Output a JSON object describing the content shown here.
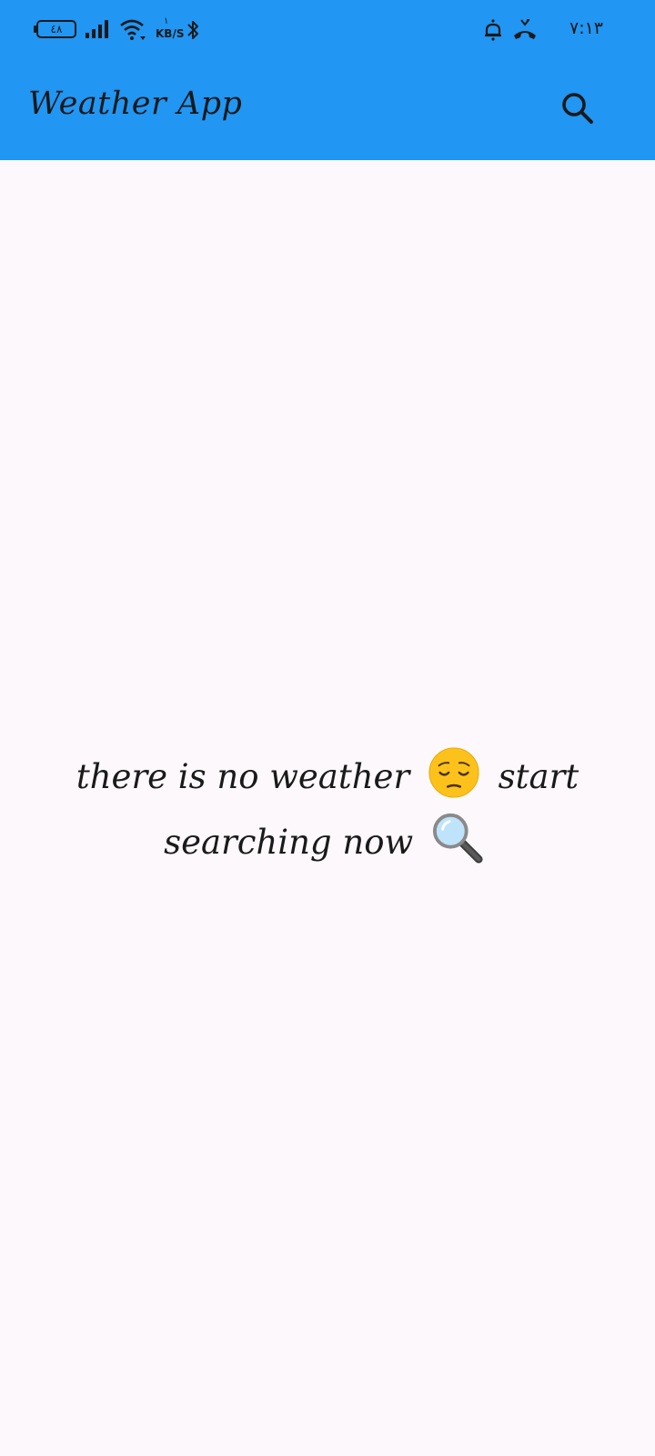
{
  "status_bar": {
    "battery_level": "٤٨",
    "network_speed_value": "١",
    "network_speed_unit": "KB/S",
    "time": "٧:١٣",
    "icons": [
      "battery-icon",
      "signal-icon",
      "wifi-icon",
      "bluetooth-icon",
      "alarm-icon",
      "call-icon"
    ]
  },
  "app_bar": {
    "title": "Weather App",
    "search_icon": "search-icon",
    "color": "#2196f3"
  },
  "empty_state": {
    "line1_text": "there is no weather",
    "line1_emoji": "pensive-face-emoji",
    "line1_end": "start",
    "line2_text": "searching now",
    "line2_emoji": "magnifying-glass-emoji"
  },
  "colors": {
    "primary": "#2196f3",
    "background": "#fdf8fc",
    "text": "#1a1a1a"
  }
}
